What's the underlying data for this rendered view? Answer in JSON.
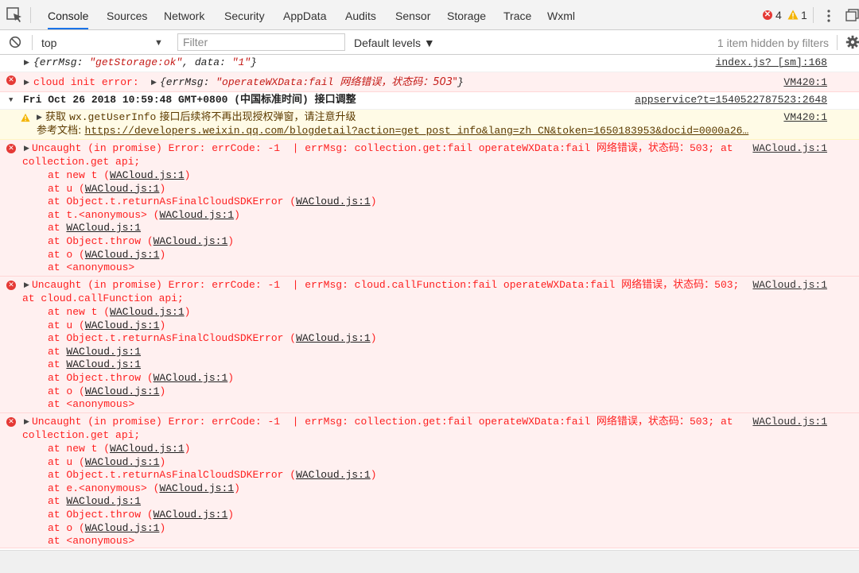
{
  "tabs": [
    {
      "label": "Console",
      "active": true
    },
    {
      "label": "Sources"
    },
    {
      "label": "Network"
    },
    {
      "label": "Security"
    },
    {
      "label": "AppData"
    },
    {
      "label": "Audits"
    },
    {
      "label": "Sensor"
    },
    {
      "label": "Storage"
    },
    {
      "label": "Trace"
    },
    {
      "label": "Wxml"
    }
  ],
  "status": {
    "errors": "4",
    "warnings": "1"
  },
  "filterbar": {
    "context": "top",
    "filter_placeholder": "Filter",
    "levels": "Default levels ▼",
    "hidden": "1 item hidden by filters"
  },
  "console": {
    "row1": {
      "text_prefix": "{errMsg: ",
      "val1": "\"getStorage:ok\"",
      "mid": ", data: ",
      "val2": "\"1\"",
      "suffix": "}",
      "source": "index.js? [sm]:168"
    },
    "row2": {
      "prefix": "cloud init error:  ",
      "obj_open": "{errMsg: ",
      "obj_val": "\"operateWXData:fail ",
      "obj_cn": "网络错误，状态码：503\"",
      "obj_close": "}",
      "source": "VM420:1"
    },
    "group": {
      "title": "Fri Oct 26 2018 10:59:48 GMT+0800 (中国标准时间) 接口调整",
      "source": "appservice?t=1540522787523:2648"
    },
    "warn": {
      "line1_prefix": "获取 ",
      "line1_code": "wx.getUserInfo",
      "line1_suffix": " 接口后续将不再出现授权弹窗，请注意升级",
      "line2_prefix": "参考文档: ",
      "line2_link": "https://developers.weixin.qq.com/blogdetail?action=get_post_info&lang=zh_CN&token=1650183953&docid=0000a26…",
      "source": "VM420:1"
    },
    "errors": [
      {
        "head": "Uncaught (in promise) Error: errCode: -1  | errMsg: collection.get:fail operateWXData:fail ",
        "head_cn": "网络错误，状态码：",
        "head_tail": "503; at",
        "line2": "collection.get api;",
        "source": "WACloud.js:1",
        "frames": [
          {
            "pre": "at new t (",
            "link": "WACloud.js:1",
            "post": ")"
          },
          {
            "pre": "at u (",
            "link": "WACloud.js:1",
            "post": ")"
          },
          {
            "pre": "at Object.t.returnAsFinalCloudSDKError (",
            "link": "WACloud.js:1",
            "post": ")"
          },
          {
            "pre": "at t.<anonymous> (",
            "link": "WACloud.js:1",
            "post": ")"
          },
          {
            "pre": "at ",
            "link": "WACloud.js:1",
            "post": ""
          },
          {
            "pre": "at Object.throw (",
            "link": "WACloud.js:1",
            "post": ")"
          },
          {
            "pre": "at o (",
            "link": "WACloud.js:1",
            "post": ")"
          },
          {
            "pre": "at <anonymous>",
            "link": "",
            "post": ""
          }
        ]
      },
      {
        "head": "Uncaught (in promise) Error: errCode: -1  | errMsg: cloud.callFunction:fail operateWXData:fail ",
        "head_cn": "网络错误，状态码：",
        "head_tail": "503;",
        "line2": "at cloud.callFunction api;",
        "source": "WACloud.js:1",
        "frames": [
          {
            "pre": "at new t (",
            "link": "WACloud.js:1",
            "post": ")"
          },
          {
            "pre": "at u (",
            "link": "WACloud.js:1",
            "post": ")"
          },
          {
            "pre": "at Object.t.returnAsFinalCloudSDKError (",
            "link": "WACloud.js:1",
            "post": ")"
          },
          {
            "pre": "at ",
            "link": "WACloud.js:1",
            "post": ""
          },
          {
            "pre": "at ",
            "link": "WACloud.js:1",
            "post": ""
          },
          {
            "pre": "at Object.throw (",
            "link": "WACloud.js:1",
            "post": ")"
          },
          {
            "pre": "at o (",
            "link": "WACloud.js:1",
            "post": ")"
          },
          {
            "pre": "at <anonymous>",
            "link": "",
            "post": ""
          }
        ]
      },
      {
        "head": "Uncaught (in promise) Error: errCode: -1  | errMsg: collection.get:fail operateWXData:fail ",
        "head_cn": "网络错误，状态码：",
        "head_tail": "503; at",
        "line2": "collection.get api;",
        "source": "WACloud.js:1",
        "frames": [
          {
            "pre": "at new t (",
            "link": "WACloud.js:1",
            "post": ")"
          },
          {
            "pre": "at u (",
            "link": "WACloud.js:1",
            "post": ")"
          },
          {
            "pre": "at Object.t.returnAsFinalCloudSDKError (",
            "link": "WACloud.js:1",
            "post": ")"
          },
          {
            "pre": "at e.<anonymous> (",
            "link": "WACloud.js:1",
            "post": ")"
          },
          {
            "pre": "at ",
            "link": "WACloud.js:1",
            "post": ""
          },
          {
            "pre": "at Object.throw (",
            "link": "WACloud.js:1",
            "post": ")"
          },
          {
            "pre": "at o (",
            "link": "WACloud.js:1",
            "post": ")"
          },
          {
            "pre": "at <anonymous>",
            "link": "",
            "post": ""
          }
        ]
      }
    ]
  }
}
